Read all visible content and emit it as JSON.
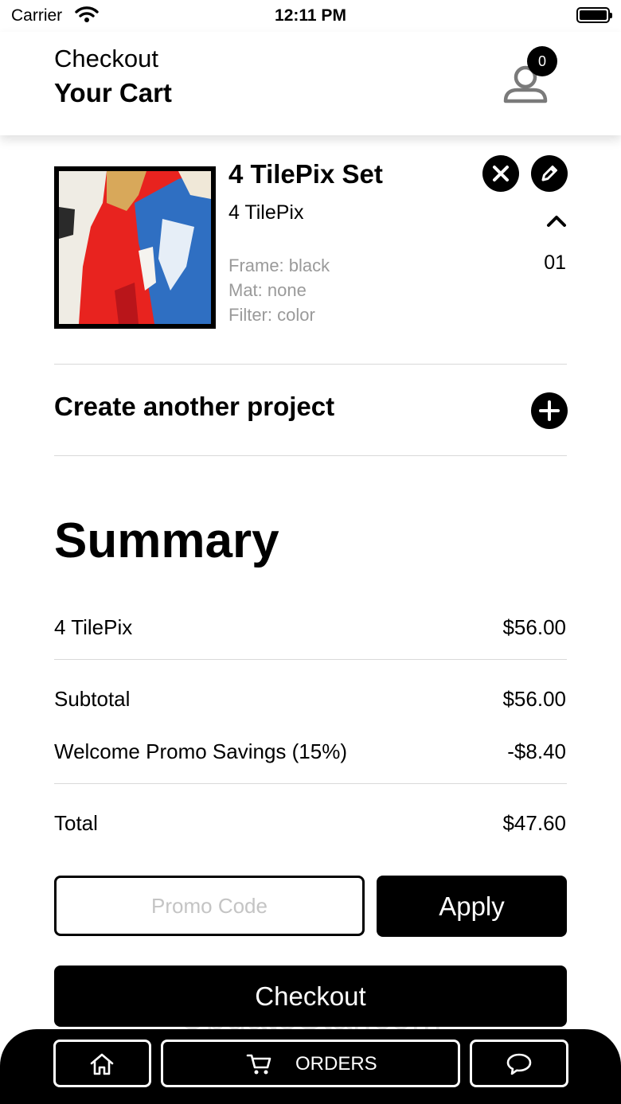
{
  "status_bar": {
    "carrier": "Carrier",
    "time": "12:11 PM",
    "icons": [
      "wifi-icon",
      "battery-icon"
    ]
  },
  "header": {
    "subtitle": "Checkout",
    "title": "Your Cart",
    "cart_count": "0",
    "profile_icon": "person-icon"
  },
  "cart_item": {
    "title": "4 TilePix Set",
    "name": "4 TilePix",
    "frame": "Frame: black",
    "mat": "Mat: none",
    "filter": "Filter: color",
    "quantity": "01",
    "image_desc": "red white blue abstract torn poster thumbnail",
    "icons": [
      "close-icon",
      "pencil-icon",
      "chevron-up-icon"
    ]
  },
  "create_project": {
    "label": "Create another project",
    "icon": "plus-icon"
  },
  "summary": {
    "title": "Summary",
    "line_item_label": "4 TilePix",
    "line_item_value": "$56.00",
    "subtotal_label": "Subtotal",
    "subtotal_value": "$56.00",
    "promo_label": "Welcome Promo Savings (15%)",
    "promo_value": "-$8.40",
    "total_label": "Total",
    "total_value": "$47.60"
  },
  "promo": {
    "placeholder": "Promo Code",
    "value": "",
    "apply_label": "Apply"
  },
  "checkout_label": "Checkout",
  "watermark": "UpdateStar.com",
  "bottom_nav": {
    "orders_label": "ORDERS",
    "icons": [
      "home-icon",
      "cart-icon",
      "chat-icon"
    ]
  },
  "colors": {
    "primary": "#000000",
    "background": "#ffffff",
    "muted_text": "#9a9a9a",
    "divider": "#d9d9d9",
    "placeholder": "#c4c4c4"
  }
}
